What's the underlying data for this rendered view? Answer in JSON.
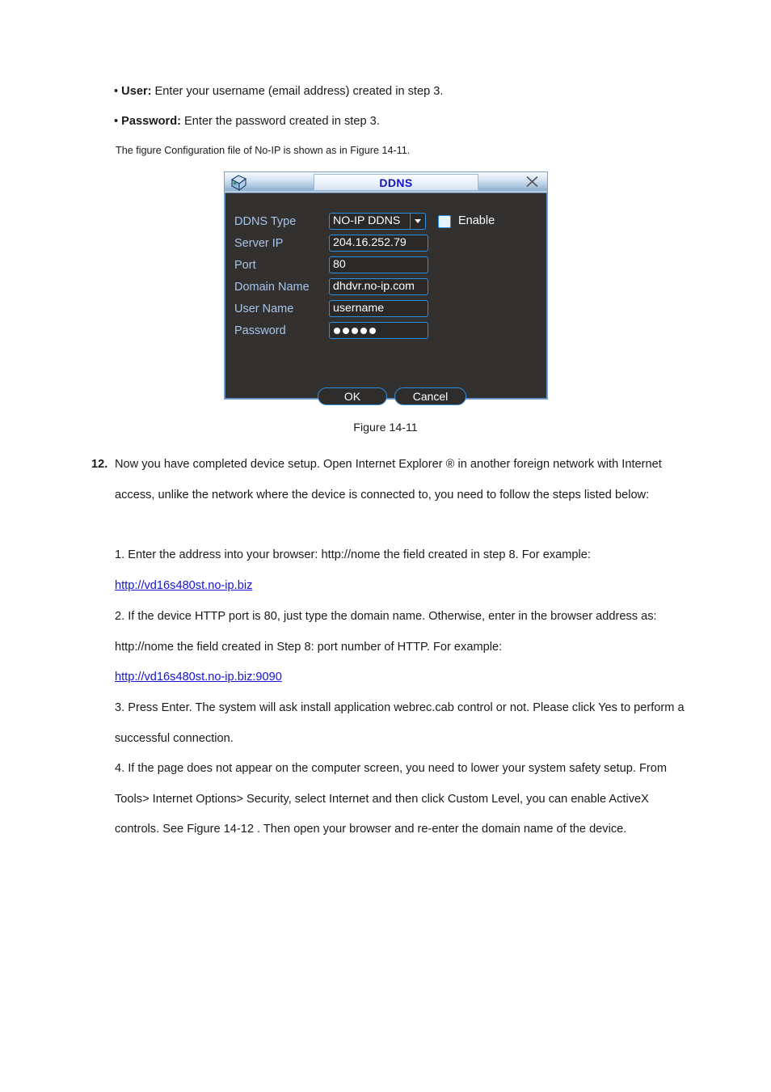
{
  "document": {
    "bullets": [
      {
        "term": "User:",
        "text": " Enter your username (email address) created in step 3."
      },
      {
        "term": "Password:",
        "text": " Enter the password created in step 3."
      }
    ],
    "note": "The figure Configuration file of No-IP is shown as in Figure 14-11.",
    "figure_caption": "Figure 14-11",
    "numbered_item": {
      "number": "12.",
      "text": "Now you have completed device setup. Open Internet Explorer ® in another foreign network with Internet access, unlike the network where the device is connected to, you need to follow the steps listed below:"
    },
    "steps": [
      {
        "text": "1. Enter the address into your browser: http://nome the field created in step 8. For example:"
      },
      {
        "text": "2. If the device HTTP port is 80, just type the domain name. Otherwise, enter in the browser address as: http://nome the field created in Step 8: port number of HTTP. For example:"
      },
      {
        "text": "3. Press Enter. The system will ask install application webrec.cab control or not. Please click Yes to perform a successful connection."
      },
      {
        "text": "4. If the page does not appear on the computer screen, you need to lower your system safety setup. From Tools> Internet Options> Security, select Internet and then click Custom Level, you can enable ActiveX controls. See Figure 14-12 . Then open your browser and re-enter the domain name of the device."
      }
    ],
    "links": [
      {
        "text": "http://vd16s480st.no-ip.biz"
      },
      {
        "text": "http://vd16s480st.no-ip.biz:9090"
      }
    ],
    "link_color": "#1414d2"
  },
  "dialog": {
    "title": "DDNS",
    "close_label": "✕",
    "icon_name": "device-cube-icon",
    "background_color": "#333030",
    "border_color": "#2e8fe0",
    "label_color": "#a8c4e8",
    "fields": {
      "ddns_type": {
        "label": "DDNS Type",
        "value": "NO-IP DDNS",
        "options": [
          "NO-IP DDNS"
        ]
      },
      "enable": {
        "label": "Enable",
        "checked": false
      },
      "server_ip": {
        "label": "Server IP",
        "value": "204.16.252.79"
      },
      "port": {
        "label": "Port",
        "value": "80"
      },
      "domain_name": {
        "label": "Domain Name",
        "value": "dhdvr.no-ip.com"
      },
      "user_name": {
        "label": "User Name",
        "value": "username"
      },
      "password": {
        "label": "Password",
        "value": "●●●●●",
        "dot_count": 5
      }
    },
    "buttons": {
      "ok": "OK",
      "cancel": "Cancel"
    }
  }
}
